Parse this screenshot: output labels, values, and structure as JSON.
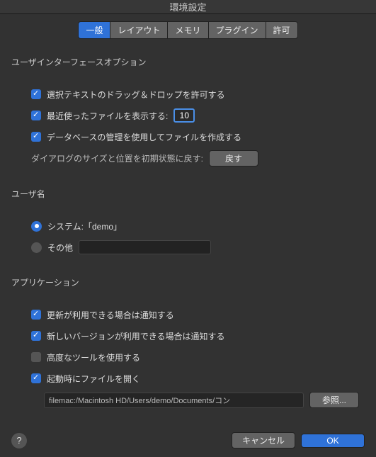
{
  "title": "環境設定",
  "tabs": [
    "一般",
    "レイアウト",
    "メモリ",
    "プラグイン",
    "許可"
  ],
  "activeTab": 0,
  "ui": {
    "section": "ユーザインターフェースオプション",
    "dragDrop": "選択テキストのドラッグ＆ドロップを許可する",
    "recentFiles": "最近使ったファイルを表示する:",
    "recentValue": "10",
    "dbManage": "データベースの管理を使用してファイルを作成する",
    "resetLabel": "ダイアログのサイズと位置を初期状態に戻す:",
    "resetBtn": "戻す"
  },
  "user": {
    "section": "ユーザ名",
    "system": "システム:「demo」",
    "other": "その他",
    "otherValue": ""
  },
  "app": {
    "section": "アプリケーション",
    "updateNotify": "更新が利用できる場合は通知する",
    "newVersionNotify": "新しいバージョンが利用できる場合は通知する",
    "advancedTools": "高度なツールを使用する",
    "openOnStart": "起動時にファイルを開く",
    "path": "filemac:/Macintosh HD/Users/demo/Documents/コン",
    "browse": "参照..."
  },
  "footer": {
    "cancel": "キャンセル",
    "ok": "OK"
  }
}
